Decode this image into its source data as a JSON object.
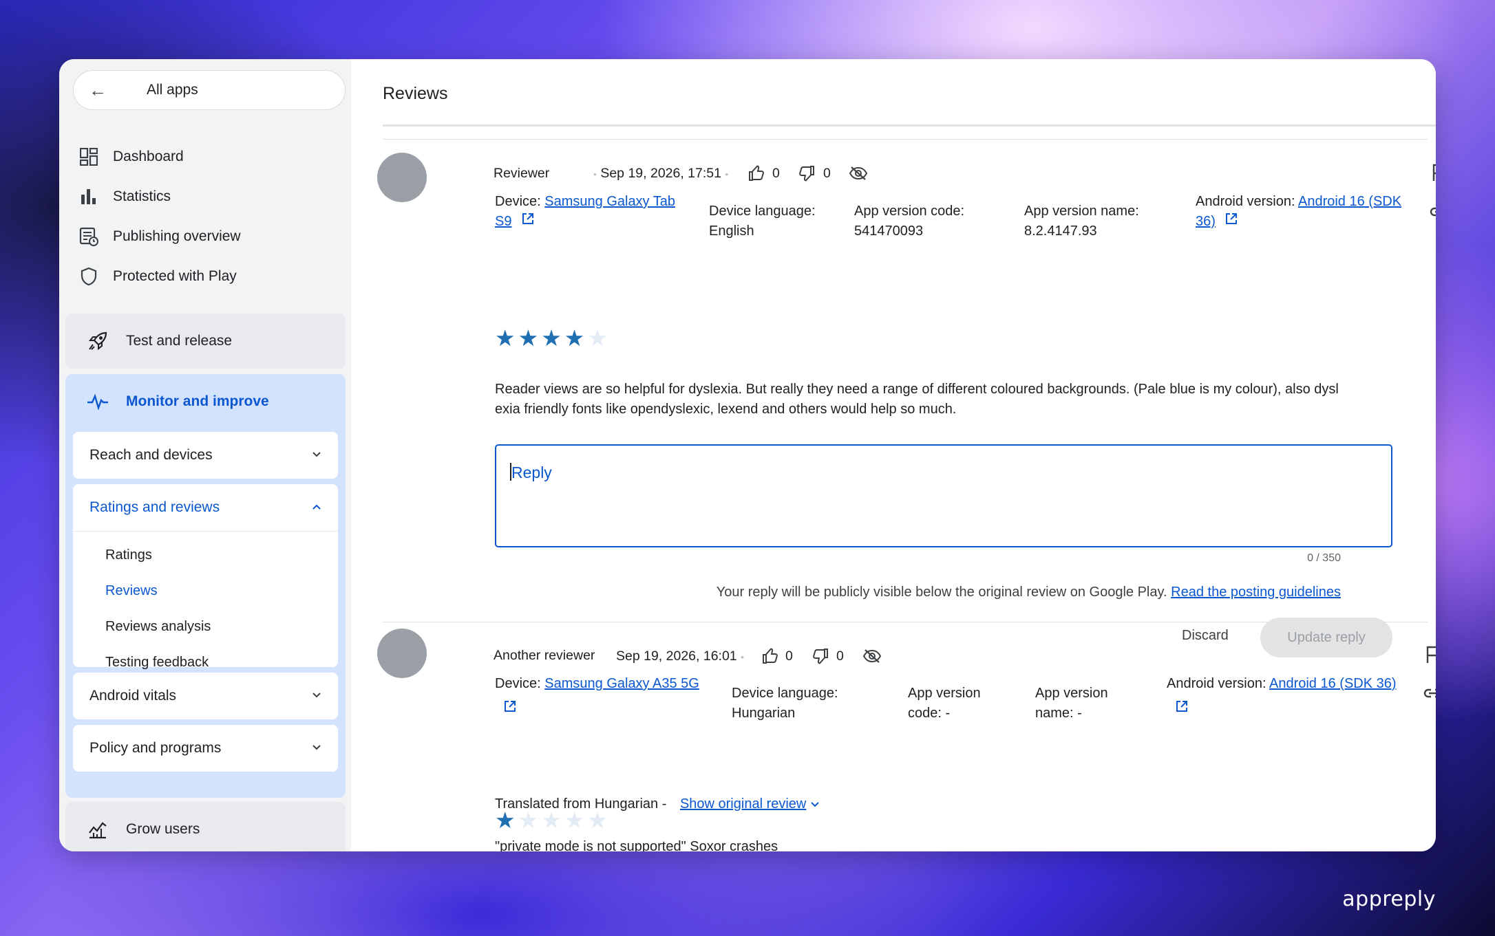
{
  "sidebar": {
    "all_apps": "All apps",
    "nav": {
      "dashboard": "Dashboard",
      "statistics": "Statistics",
      "publishing_overview": "Publishing overview",
      "protected_with_play": "Protected with Play"
    },
    "test_and_release": "Test and release",
    "monitor_and_improve": "Monitor and improve",
    "reach_and_devices": "Reach and devices",
    "ratings_and_reviews": "Ratings and reviews",
    "ratings_sub": {
      "ratings": "Ratings",
      "reviews": "Reviews",
      "reviews_analysis": "Reviews analysis",
      "testing_feedback": "Testing feedback"
    },
    "android_vitals": "Android vitals",
    "policy_and_programs": "Policy and programs",
    "grow_users": "Grow users"
  },
  "main": {
    "title": "Reviews",
    "reviews": [
      {
        "reviewer": "Reviewer",
        "datetime": "Sep 19, 2026, 17:51",
        "thumbs_up": "0",
        "thumbs_down": "0",
        "device_label": "Device:",
        "device_line1": "Samsung Galaxy Tab",
        "device_line2": "S9",
        "device_language_label": "Device language:",
        "device_language": "English",
        "app_version_code_label": "App version code:",
        "app_version_code": "541470093",
        "app_version_name_label": "App version name:",
        "app_version_name": "8.2.4147.93",
        "android_version_label": "Android version:",
        "android_version_line1": "Android 16 (SDK",
        "android_version_line2": "36)",
        "rating": 4,
        "text_line1": "Reader views are so helpful for dyslexia. But really they need a range of different coloured backgrounds. (Pale blue is my colour), also dysl",
        "text_line2": "exia friendly fonts like opendyslexic, lexend and others would help so much.",
        "reply_placeholder": "Reply",
        "reply_counter": "0 / 350",
        "reply_notice": "Your reply will be publicly visible below the original review on Google Play.",
        "reply_guidelines_link": "Read the posting guidelines",
        "discard_label": "Discard",
        "update_reply_label": "Update reply"
      },
      {
        "reviewer": "Another reviewer",
        "datetime": "Sep 19, 2026, 16:01",
        "thumbs_up": "0",
        "thumbs_down": "0",
        "device_label": "Device:",
        "device": "Samsung Galaxy A35 5G",
        "device_language_label": "Device language:",
        "device_language": "Hungarian",
        "app_version_code_label_1": "App version",
        "app_version_code_label_2": "code: -",
        "app_version_name_label_1": "App version",
        "app_version_name_label_2": "name: -",
        "android_version_label": "Android version:",
        "android_version": "Android 16 (SDK 36)",
        "rating": 1,
        "translated_from": "Translated from Hungarian -",
        "show_original": "Show original review",
        "text_partial": "\"private mode is not supported\" Soxor crashes"
      }
    ]
  },
  "brand": "appreply",
  "colors": {
    "accent": "#0b57d0",
    "star": "#1f6fb2",
    "active_section_bg": "#d3e3fd"
  }
}
